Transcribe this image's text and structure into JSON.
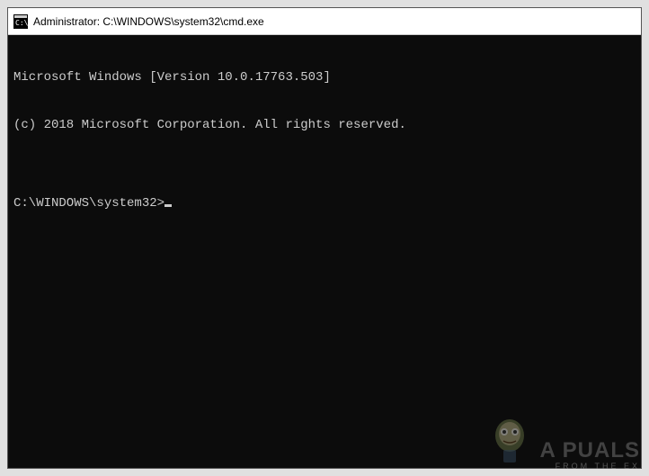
{
  "window": {
    "title": "Administrator: C:\\WINDOWS\\system32\\cmd.exe"
  },
  "terminal": {
    "line1": "Microsoft Windows [Version 10.0.17763.503]",
    "line2": "(c) 2018 Microsoft Corporation. All rights reserved.",
    "blank": "",
    "prompt": "C:\\WINDOWS\\system32>"
  },
  "watermark": {
    "main": "A  PUALS",
    "sub": "FROM THE EX"
  }
}
